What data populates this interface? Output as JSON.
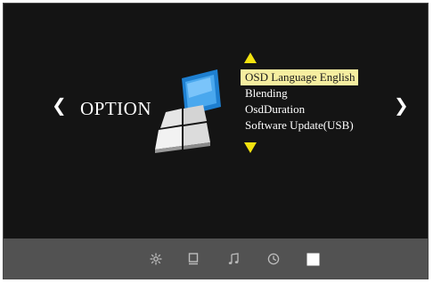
{
  "screen": {
    "section_title": "OPTION",
    "nav_prev_icon": "chevron-left-icon",
    "nav_next_icon": "chevron-right-icon",
    "section_icon": "option-icon"
  },
  "menu": {
    "scroll_up_icon": "triangle-up-icon",
    "scroll_down_icon": "triangle-down-icon",
    "items": [
      {
        "label": "OSD Language English",
        "selected": true
      },
      {
        "label": "Blending",
        "selected": false
      },
      {
        "label": "OsdDuration",
        "selected": false
      },
      {
        "label": "Software Update(USB)",
        "selected": false
      }
    ],
    "highlight_color": "#f6eea0",
    "arrow_color": "#f3e20f"
  },
  "tab_bar": {
    "tabs": [
      {
        "icon": "picture-settings-icon",
        "active": false
      },
      {
        "icon": "screen-icon",
        "active": false
      },
      {
        "icon": "music-note-icon",
        "active": false
      },
      {
        "icon": "clock-icon",
        "active": false
      },
      {
        "icon": "option-square-icon",
        "active": true
      }
    ]
  }
}
